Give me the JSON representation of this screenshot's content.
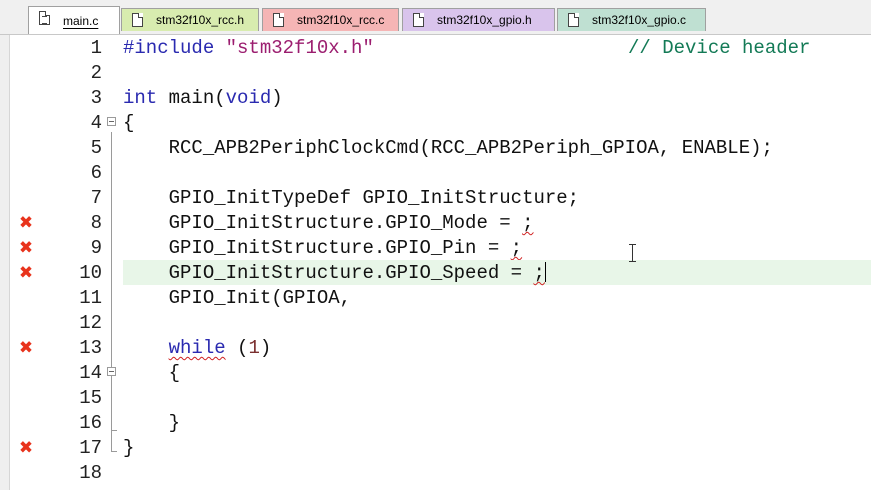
{
  "tabs": [
    {
      "label": "main.c",
      "active": true,
      "color": "#ffffff"
    },
    {
      "label": "stm32f10x_rcc.h",
      "active": false,
      "color": "#d8ecaf"
    },
    {
      "label": "stm32f10x_rcc.c",
      "active": false,
      "color": "#f5b5b5"
    },
    {
      "label": "stm32f10x_gpio.h",
      "active": false,
      "color": "#d9c4ec"
    },
    {
      "label": "stm32f10x_gpio.c",
      "active": false,
      "color": "#bfe0d2"
    }
  ],
  "editor": {
    "error_marker": "✖",
    "highlighted_line": 10,
    "lines": [
      {
        "n": "1"
      },
      {
        "n": "2"
      },
      {
        "n": "3"
      },
      {
        "n": "4"
      },
      {
        "n": "5"
      },
      {
        "n": "6"
      },
      {
        "n": "7"
      },
      {
        "n": "8"
      },
      {
        "n": "9"
      },
      {
        "n": "10"
      },
      {
        "n": "11"
      },
      {
        "n": "12"
      },
      {
        "n": "13"
      },
      {
        "n": "14"
      },
      {
        "n": "15"
      },
      {
        "n": "16"
      },
      {
        "n": "17"
      },
      {
        "n": "18"
      }
    ],
    "code": {
      "l1_directive": "#include",
      "l1_string": "\"stm32f10x.h\"",
      "l1_comment": "// Device header",
      "l3_int": "int",
      "l3_main": " main(",
      "l3_void": "void",
      "l3_close": ")",
      "l4": "{",
      "l5": "    RCC_APB2PeriphClockCmd(RCC_APB2Periph_GPIOA, ENABLE);",
      "l7": "    GPIO_InitTypeDef GPIO_InitStructure;",
      "l8": "    GPIO_InitStructure.GPIO_Mode = ",
      "l9": "    GPIO_InitStructure.GPIO_Pin = ",
      "l10": "    GPIO_InitStructure.GPIO_Speed = ",
      "semicolon": ";",
      "l11": "    GPIO_Init(GPIOA,",
      "l13_indent": "    ",
      "l13_while": "while",
      "l13_open": " (",
      "l13_one": "1",
      "l13_close": ")",
      "l14": "    {",
      "l16": "    }",
      "l17": "}"
    }
  }
}
